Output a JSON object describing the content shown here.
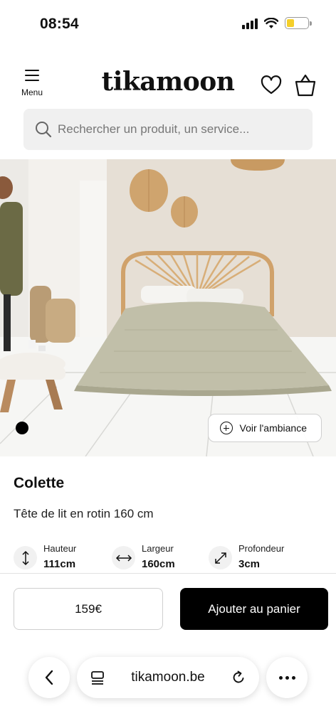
{
  "status_bar": {
    "time": "08:54",
    "battery_level": 0.35,
    "battery_color": "#f5cf2a"
  },
  "header": {
    "menu_label": "Menu",
    "logo": "tikamoon",
    "wishlist_icon": "heart-icon",
    "cart_icon": "shopping-bag-icon"
  },
  "search": {
    "placeholder": "Rechercher un produit, un service..."
  },
  "hero": {
    "ambiance_label": "Voir l'ambiance",
    "slide_count": 1,
    "active_slide": 1
  },
  "product": {
    "name": "Colette",
    "description": "Tête de lit en rotin 160 cm",
    "dimensions": [
      {
        "label": "Hauteur",
        "value": "111cm",
        "icon": "vertical-arrow-icon"
      },
      {
        "label": "Largeur",
        "value": "160cm",
        "icon": "horizontal-arrow-icon"
      },
      {
        "label": "Profondeur",
        "value": "3cm",
        "icon": "diagonal-arrow-icon"
      }
    ],
    "price": "159€",
    "add_to_cart": "Ajouter au panier"
  },
  "browser": {
    "url": "tikamoon.be",
    "back_icon": "chevron-left-icon",
    "tabs_icon": "tabs-icon",
    "reload_icon": "reload-icon",
    "more_icon": "more-icon"
  },
  "colors": {
    "accent": "#000000",
    "search_bg": "#f0f0f0"
  }
}
